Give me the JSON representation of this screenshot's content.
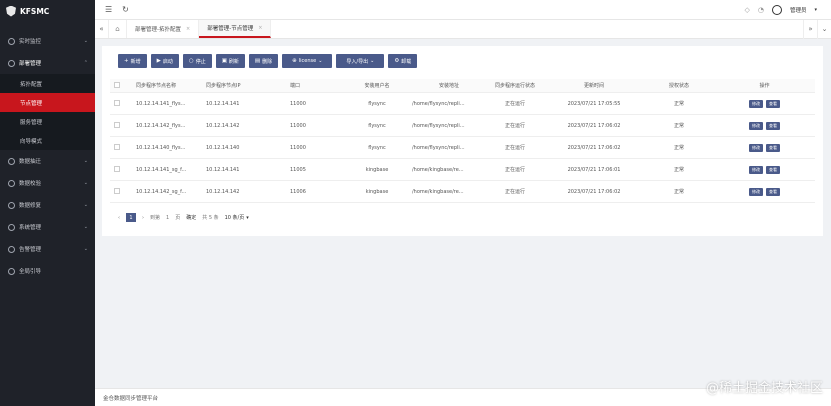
{
  "brand": {
    "title": "KFSMC"
  },
  "sidebar": {
    "items": [
      {
        "label": "实时监控",
        "icon": "monitor-icon",
        "expandable": true
      },
      {
        "label": "部署管理",
        "icon": "deploy-icon",
        "expandable": true,
        "open": true
      },
      {
        "label": "数据抽迁",
        "icon": "data-migrate-icon",
        "expandable": true
      },
      {
        "label": "数据校验",
        "icon": "data-verify-icon",
        "expandable": true
      },
      {
        "label": "数据修复",
        "icon": "data-repair-icon",
        "expandable": true
      },
      {
        "label": "系统管理",
        "icon": "system-icon",
        "expandable": true
      },
      {
        "label": "告警管理",
        "icon": "alarm-icon",
        "expandable": true
      },
      {
        "label": "全局引导",
        "icon": "guide-icon",
        "expandable": false
      }
    ],
    "sub_items": [
      {
        "label": "拓扑配置",
        "active": false
      },
      {
        "label": "节点管理",
        "active": true
      },
      {
        "label": "服务管理",
        "active": false
      },
      {
        "label": "向导模式",
        "active": false
      }
    ]
  },
  "topbar": {
    "user_label": "管理员"
  },
  "tabs": [
    {
      "label": "部署管理-拓扑配置",
      "active": false
    },
    {
      "label": "部署管理-节点管理",
      "active": true
    }
  ],
  "toolbar": {
    "buttons": [
      {
        "label": "新增",
        "icon": "plus-icon"
      },
      {
        "label": "启动",
        "icon": "play-icon"
      },
      {
        "label": "停止",
        "icon": "stop-icon"
      },
      {
        "label": "刷新",
        "icon": "refresh-icon"
      },
      {
        "label": "删除",
        "icon": "delete-icon"
      },
      {
        "label": "license",
        "icon": "license-icon"
      },
      {
        "label": "导入/导出",
        "icon": "import-export-icon"
      },
      {
        "label": "卸载",
        "icon": "uninstall-icon"
      }
    ]
  },
  "table": {
    "columns": [
      "同步程序节点名称",
      "同步程序节点IP",
      "端口",
      "安装用户名",
      "安装地址",
      "同步程序运行状态",
      "更新时间",
      "授权状态",
      "操作"
    ],
    "rows": [
      {
        "name": "10.12.14.141_flys...",
        "ip": "10.12.14.141",
        "port": "11000",
        "user": "flysync",
        "dir": "/home/flysync/repli...",
        "state": "正在运行",
        "time": "2023/07/21 17:05:55",
        "auth": "正常"
      },
      {
        "name": "10.12.14.142_flys...",
        "ip": "10.12.14.142",
        "port": "11000",
        "user": "flysync",
        "dir": "/home/flysync/repli...",
        "state": "正在运行",
        "time": "2023/07/21 17:06:02",
        "auth": "正常"
      },
      {
        "name": "10.12.14.140_flys...",
        "ip": "10.12.14.140",
        "port": "11000",
        "user": "flysync",
        "dir": "/home/flysync/repli...",
        "state": "正在运行",
        "time": "2023/07/21 17:06:02",
        "auth": "正常"
      },
      {
        "name": "10.12.14.141_sg_f...",
        "ip": "10.12.14.141",
        "port": "11005",
        "user": "kingbase",
        "dir": "/home/kingbase/re...",
        "state": "正在运行",
        "time": "2023/07/21 17:06:01",
        "auth": "正常"
      },
      {
        "name": "10.12.14.142_sg_f...",
        "ip": "10.12.14.142",
        "port": "11006",
        "user": "kingbase",
        "dir": "/home/kingbase/re...",
        "state": "正在运行",
        "time": "2023/07/21 17:06:02",
        "auth": "正常"
      }
    ],
    "row_actions": {
      "edit": "修改",
      "view": "查看"
    }
  },
  "pager": {
    "current": "1",
    "goto_label": "到第",
    "page_unit": "页",
    "confirm": "确定",
    "total": "共 5 条",
    "page_size": "10 条/页"
  },
  "footer": {
    "text": "金仓数据同步管理平台"
  },
  "watermark": {
    "text": "@稀土掘金技术社区"
  }
}
